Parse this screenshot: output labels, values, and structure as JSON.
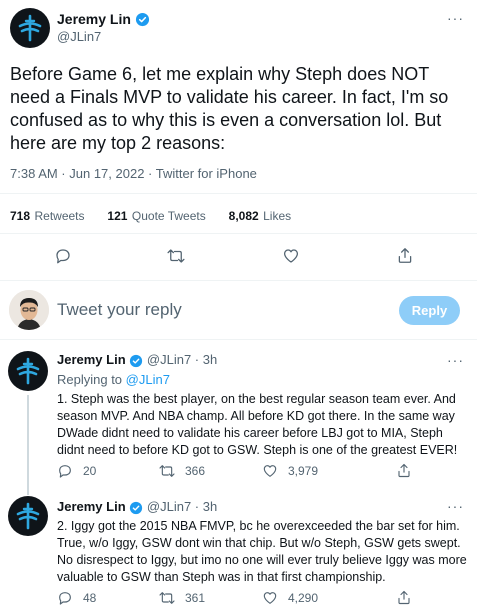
{
  "main_tweet": {
    "author_name": "Jeremy Lin",
    "handle": "@JLin7",
    "text": "Before Game 6, let me explain why Steph does NOT need a Finals MVP to validate his career. In fact, I'm so confused as to why this is even a conversation lol. But here are my top 2 reasons:",
    "timestamp": "7:38 AM · Jun 17, 2022 · Twitter for iPhone",
    "stats": {
      "retweets_count": "718",
      "retweets_label": "Retweets",
      "quotes_count": "121",
      "quotes_label": "Quote Tweets",
      "likes_count": "8,082",
      "likes_label": "Likes"
    }
  },
  "composer": {
    "placeholder": "Tweet your reply",
    "reply_button": "Reply"
  },
  "replies": [
    {
      "author_name": "Jeremy Lin",
      "handle_time": "@JLin7 · 3h",
      "replying_prefix": "Replying to",
      "replying_to": "@JLin7",
      "text": "1. Steph was the best player, on the best regular season team ever. And season MVP. And NBA champ. All before KD got there. In the same way DWade didnt need to validate his career before LBJ got to MIA, Steph didnt need to before KD got to GSW. Steph is one of the greatest EVER!",
      "replies": "20",
      "retweets": "366",
      "likes": "3,979"
    },
    {
      "author_name": "Jeremy Lin",
      "handle_time": "@JLin7 · 3h",
      "text": "2. Iggy got the 2015 NBA FMVP, bc he overexceeded the bar set for him. True, w/o Iggy, GSW dont win that chip. But w/o Steph, GSW gets swept. No disrespect to Iggy, but imo no one will ever truly believe Iggy was more valuable to GSW than Steph was in that first championship.",
      "replies": "48",
      "retweets": "361",
      "likes": "4,290"
    }
  ],
  "colors": {
    "accent": "#1d9bf0",
    "reply_button_bg": "#8ecdf8",
    "muted": "#536471",
    "divider": "#eff3f4"
  }
}
